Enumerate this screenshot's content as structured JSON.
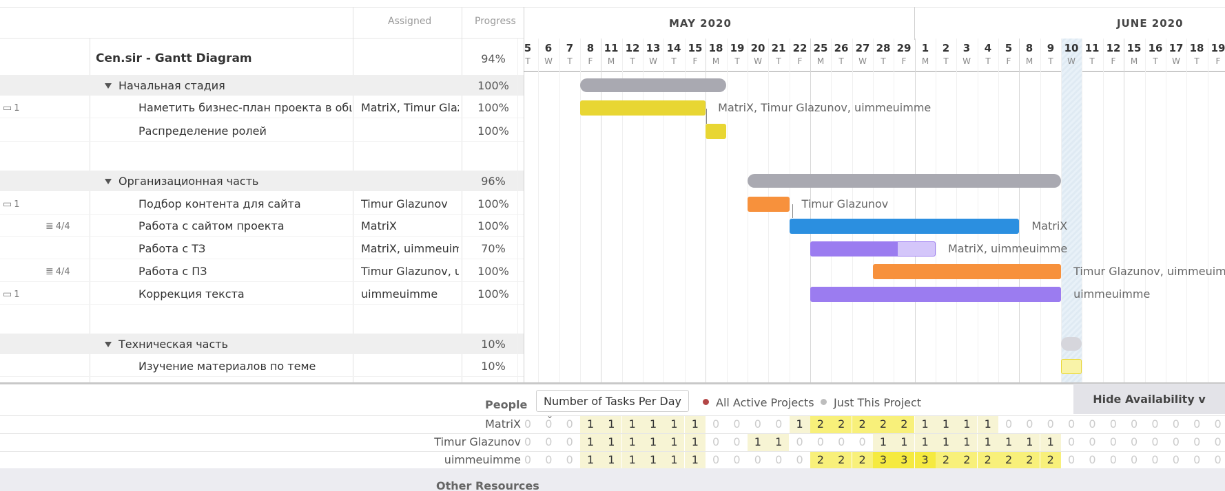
{
  "header": {
    "assigned_label": "Assigned",
    "progress_label": "Progress",
    "months": [
      "MAY 2020",
      "JUNE 2020"
    ]
  },
  "timeline": {
    "days": [
      "5",
      "6",
      "7",
      "8",
      "11",
      "12",
      "13",
      "14",
      "15",
      "18",
      "19",
      "20",
      "21",
      "22",
      "25",
      "26",
      "27",
      "28",
      "29",
      "1",
      "2",
      "3",
      "4",
      "5",
      "8",
      "9",
      "10",
      "11",
      "12",
      "15",
      "16",
      "17",
      "18",
      "19"
    ],
    "weekdays": [
      "T",
      "W",
      "T",
      "F",
      "M",
      "T",
      "W",
      "T",
      "F",
      "M",
      "T",
      "W",
      "T",
      "F",
      "M",
      "T",
      "W",
      "T",
      "F",
      "M",
      "T",
      "W",
      "T",
      "F",
      "M",
      "T",
      "W",
      "T",
      "F",
      "M",
      "T",
      "W",
      "T",
      "F"
    ],
    "today": "10"
  },
  "project": {
    "name": "Cen.sir - Gantt Diagram",
    "progress": "94%"
  },
  "rows": [
    {
      "kind": "group",
      "name": "Начальная стадия",
      "progress": "100%"
    },
    {
      "kind": "task",
      "name": "Наметить бизнес-план проекта в общи...",
      "assigned": "MatriX, Timur Glazunov",
      "progress": "100%",
      "badge": "1",
      "badge_icon": "comment-icon",
      "bar_label": "MatriX, Timur Glazunov, uimmeuimme"
    },
    {
      "kind": "task",
      "name": "Распределение ролей",
      "assigned": "",
      "progress": "100%",
      "bar_label": ""
    },
    {
      "kind": "group",
      "name": "Организационная часть",
      "progress": "96%"
    },
    {
      "kind": "task",
      "name": "Подбор контента для сайта",
      "assigned": "Timur Glazunov",
      "progress": "100%",
      "badge": "1",
      "badge_icon": "comment-icon",
      "bar_label": "Timur Glazunov"
    },
    {
      "kind": "task",
      "name": "Работа с сайтом проекта",
      "assigned": "MatriX",
      "progress": "100%",
      "badge": "4/4",
      "badge_icon": "checklist-icon",
      "bar_label": "MatriX"
    },
    {
      "kind": "task",
      "name": "Работа с ТЗ",
      "assigned": "MatriX, uimmeuimme",
      "progress": "70%",
      "bar_label": "MatriX, uimmeuimme"
    },
    {
      "kind": "task",
      "name": "Работа с ПЗ",
      "assigned": "Timur Glazunov, uimmeuimme",
      "progress": "100%",
      "badge": "4/4",
      "badge_icon": "checklist-icon",
      "bar_label": "Timur Glazunov, uimmeuimme"
    },
    {
      "kind": "task",
      "name": "Коррекция текста",
      "assigned": "uimmeuimme",
      "progress": "100%",
      "badge": "1",
      "badge_icon": "comment-icon",
      "bar_label": "uimmeuimme"
    },
    {
      "kind": "group",
      "name": "Техническая часть",
      "progress": "10%"
    },
    {
      "kind": "task",
      "name": "Изучение материалов по теме",
      "assigned": "",
      "progress": "10%",
      "bar_label": ""
    }
  ],
  "availability": {
    "people_label": "People",
    "metric": "Number of Tasks Per Day",
    "radio_all": "All Active Projects",
    "radio_this": "Just This Project",
    "hide_label": "Hide Availability v",
    "other_label": "Other Resources",
    "people": [
      {
        "name": "MatriX",
        "counts": [
          "0",
          "0",
          "0",
          "1",
          "1",
          "1",
          "1",
          "1",
          "1",
          "0",
          "0",
          "0",
          "0",
          "1",
          "2",
          "2",
          "2",
          "2",
          "2",
          "1",
          "1",
          "1",
          "1",
          "0",
          "0",
          "0",
          "0",
          "0",
          "0",
          "0",
          "0",
          "0",
          "0",
          "0"
        ]
      },
      {
        "name": "Timur Glazunov",
        "counts": [
          "0",
          "0",
          "0",
          "1",
          "1",
          "1",
          "1",
          "1",
          "1",
          "0",
          "0",
          "1",
          "1",
          "0",
          "0",
          "0",
          "0",
          "1",
          "1",
          "1",
          "1",
          "1",
          "1",
          "1",
          "1",
          "1",
          "0",
          "0",
          "0",
          "0",
          "0",
          "0",
          "0",
          "0"
        ]
      },
      {
        "name": "uimmeuimme",
        "counts": [
          "0",
          "0",
          "0",
          "1",
          "1",
          "1",
          "1",
          "1",
          "1",
          "0",
          "0",
          "0",
          "0",
          "0",
          "2",
          "2",
          "2",
          "3",
          "3",
          "3",
          "2",
          "2",
          "2",
          "2",
          "2",
          "2",
          "0",
          "0",
          "0",
          "0",
          "0",
          "0",
          "0",
          "0"
        ]
      }
    ]
  },
  "colors": {
    "summary": "#a9a9b1",
    "yellow": "#e8d633",
    "orange": "#f7913c",
    "blue": "#2b8fe0",
    "purple": "#9b7cf0",
    "purple_light": "#d4c6fa",
    "avail_low": "#f7f4d4",
    "avail_mid": "#f8f07a",
    "avail_high": "#f5ea40"
  }
}
